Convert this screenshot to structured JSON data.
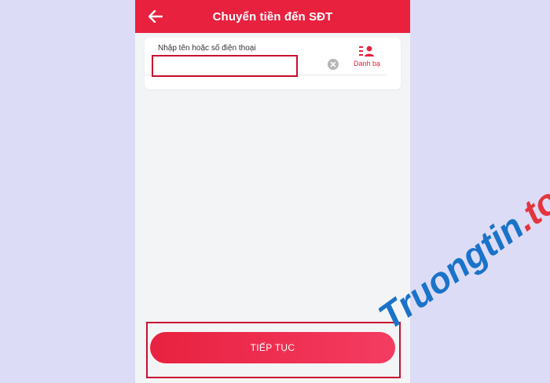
{
  "header": {
    "title": "Chuyển tiền đến SĐT",
    "back_icon": "arrow-left-icon"
  },
  "input_card": {
    "label": "Nhập tên hoặc số điện thoại",
    "value": "",
    "clear_icon": "clear-circle-icon",
    "contacts_icon": "contacts-list-icon",
    "contacts_label": "Danh bạ"
  },
  "footer": {
    "continue_label": "TIẾP TỤC"
  },
  "watermark": {
    "text": "Truongtin.top",
    "color_blue": "#1a73c8",
    "color_red": "#e4353e"
  },
  "colors": {
    "brand": "#e8213f",
    "background": "#dcdcf6",
    "screen": "#f3f4f6",
    "highlight": "#c8102e"
  }
}
